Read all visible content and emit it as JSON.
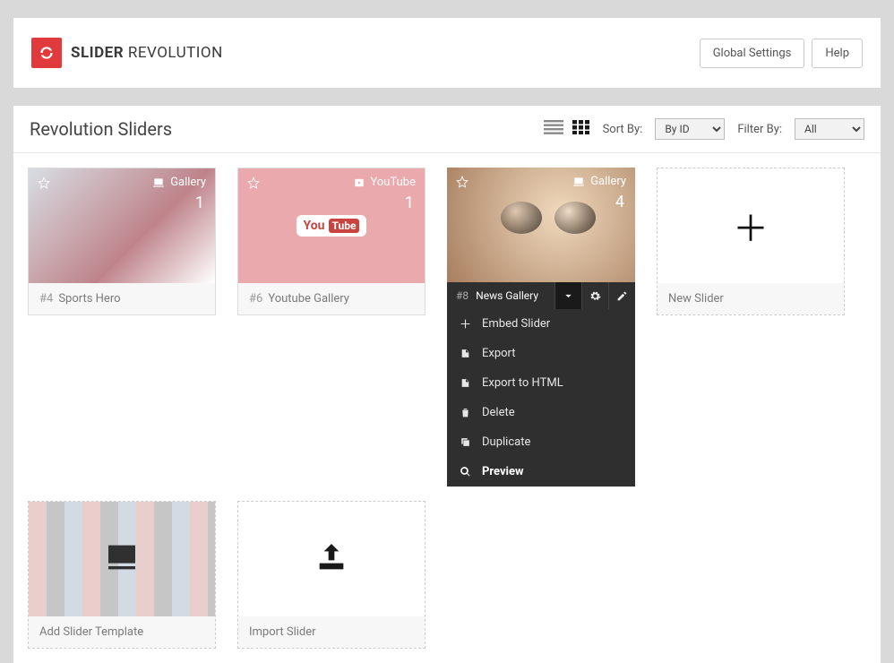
{
  "header": {
    "brand_bold": "SLIDER",
    "brand_light": " REVOLUTION",
    "buttons": {
      "global": "Global Settings",
      "help": "Help"
    }
  },
  "panel": {
    "title": "Revolution Sliders",
    "sort_label": "Sort By:",
    "sort_value": "By ID",
    "filter_label": "Filter By:",
    "filter_value": "All"
  },
  "cards": [
    {
      "id": "#4",
      "title": "Sports Hero",
      "type": "Gallery",
      "count": "1"
    },
    {
      "id": "#6",
      "title": "Youtube Gallery",
      "type": "YouTube",
      "count": "1"
    },
    {
      "id": "#8",
      "title": "News Gallery",
      "type": "Gallery",
      "count": "4"
    }
  ],
  "menu": {
    "embed": "Embed Slider",
    "export": "Export",
    "export_html": "Export to HTML",
    "delete": "Delete",
    "duplicate": "Duplicate",
    "preview": "Preview"
  },
  "tiles": {
    "new": "New Slider",
    "add_tpl": "Add Slider Template",
    "import": "Import Slider"
  }
}
